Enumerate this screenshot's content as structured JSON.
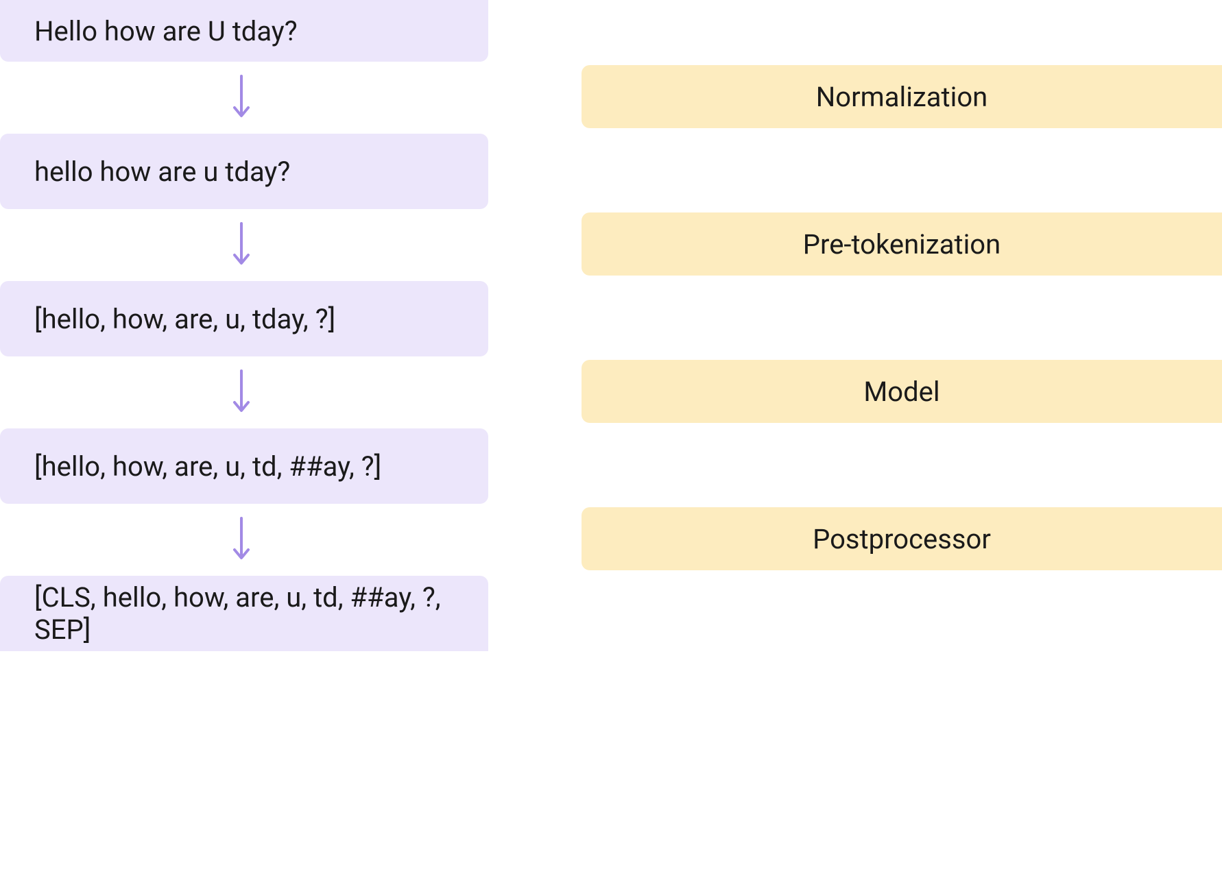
{
  "pipeline": {
    "boxes": [
      "Hello how are U tday?",
      "hello how are u tday?",
      "[hello, how, are, u, tday, ?]",
      "[hello, how, are, u, td, ##ay, ?]",
      "[CLS, hello, how, are, u, td, ##ay, ?, SEP]"
    ]
  },
  "stages": [
    "Normalization",
    "Pre-tokenization",
    "Model",
    "Postprocessor"
  ],
  "colors": {
    "data_box_bg": "#ece6fb",
    "stage_box_bg": "#fdecbf",
    "arrow": "#a28ae5",
    "text": "#1a1a1a"
  }
}
